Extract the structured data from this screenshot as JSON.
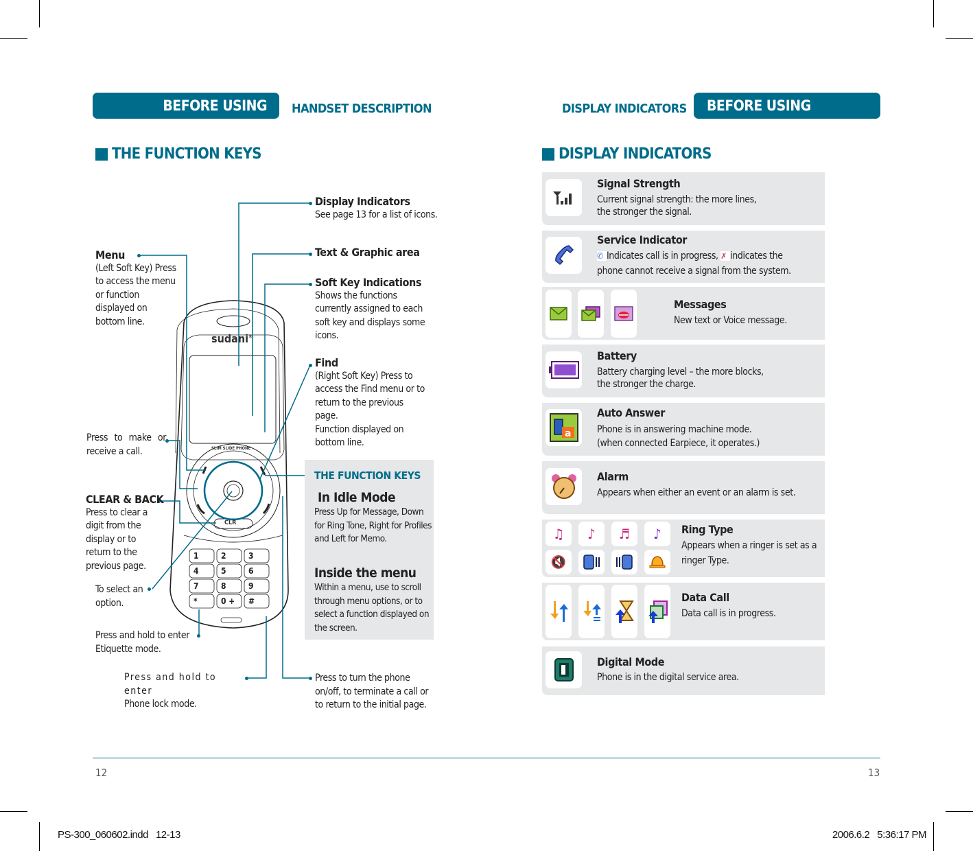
{
  "left_page": {
    "header_pill": "BEFORE USING",
    "header_section": "HANDSET DESCRIPTION",
    "section_title": "THE FUNCTION KEYS",
    "phone": {
      "brand": "sudani",
      "trademark": "®",
      "ring_text": "SLIM SLIDE PHONE",
      "clr_label": "CLR",
      "keys": [
        "1",
        "2",
        "3",
        "4",
        "5",
        "6",
        "7",
        "8",
        "9",
        "*",
        "0 +",
        "#"
      ]
    },
    "callouts": {
      "display_indicators": {
        "title": "Display Indicators",
        "text": "See page 13 for a list of icons."
      },
      "text_graphic": {
        "title": "Text & Graphic area"
      },
      "soft_key_indications": {
        "title": "Soft Key Indications",
        "text": "Shows the functions currently assigned to each soft key and displays some icons."
      },
      "menu": {
        "title": "Menu",
        "text": "(Left Soft Key) Press to access the menu or function displayed on bottom line."
      },
      "find": {
        "title": "Find",
        "text": "(Right Soft Key) Press to access the Find menu or to return to the previous page.",
        "text2": "Function displayed on bottom line."
      },
      "send": {
        "text": "Press to make or receive a call."
      },
      "clear_back": {
        "title": "CLEAR & BACK",
        "text": "Press to clear a digit from the display or to return to the previous page."
      },
      "select": {
        "text": "To select an option."
      },
      "etiquette": {
        "text": "Press and hold to enter Etiquette mode."
      },
      "lock": {
        "text": "Press and hold to enter",
        "text2": "Phone lock mode."
      },
      "power": {
        "text": "Press to turn the phone on/off, to terminate a call or to return to the initial page."
      }
    },
    "function_keys_box": {
      "title": "THE FUNCTION KEYS",
      "idle_heading": "In Idle Mode",
      "idle_text": "Press Up for Message, Down for Ring Tone, Right for Profiles and Left for Memo.",
      "menu_heading": "Inside the menu",
      "menu_text": "Within a menu, use to scroll through menu options, or to select a function displayed on the screen."
    },
    "page_number": "12"
  },
  "right_page": {
    "header_section": "DISPLAY INDICATORS",
    "header_pill": "BEFORE USING",
    "section_title": "DISPLAY INDICATORS",
    "indicators": [
      {
        "title": "Signal Strength",
        "desc": "Current signal strength: the more lines,",
        "desc2": "the stronger the signal.",
        "icons": [
          "signal-icon"
        ]
      },
      {
        "title": "Service Indicator",
        "desc": "Indicates call is in progress,",
        "desc_b": "indicates the",
        "desc2": "phone cannot receive a signal from the system.",
        "icons": [
          "handset-icon"
        ]
      },
      {
        "title": "Messages",
        "desc": "New text or  Voice message.",
        "icons": [
          "envelope-icon",
          "envelopes-icon",
          "voice-message-icon"
        ]
      },
      {
        "title": "Battery",
        "desc": "Battery charging level – the more blocks,",
        "desc2": "the stronger the charge.",
        "icons": [
          "battery-icon"
        ]
      },
      {
        "title": "Auto Answer",
        "desc": "Phone is in answering machine mode.",
        "desc2": "(when connected Earpiece, it operates.)",
        "icons": [
          "auto-answer-icon"
        ]
      },
      {
        "title": "Alarm",
        "desc": "Appears when either an event or an alarm is set.",
        "icons": [
          "alarm-clock-icon"
        ]
      },
      {
        "title": "Ring Type",
        "desc": "Appears when a ringer is set as a",
        "desc2": "ringer Type.",
        "icons": [
          "ring-icon",
          "vibrate-icon",
          "ring-vibrate-icon",
          "melody-icon",
          "silent-icon",
          "vibrate-left-icon",
          "vibrate-right-icon",
          "bell-icon"
        ]
      },
      {
        "title": "Data Call",
        "desc": "Data call is in progress.",
        "icons": [
          "data-transfer-icon",
          "data-transfer-alt-icon",
          "data-wait-icon",
          "data-window-icon"
        ]
      },
      {
        "title": "Digital Mode",
        "desc": "Phone is in the digital service area.",
        "icons": [
          "digital-mode-icon"
        ]
      }
    ],
    "page_number": "13"
  },
  "slug": {
    "file": "PS-300_060602.indd   12-13",
    "timestamp": "2006.6.2   5:36:17 PM"
  },
  "colors": {
    "accent": "#006c8b",
    "panel": "#e6e7e8"
  }
}
